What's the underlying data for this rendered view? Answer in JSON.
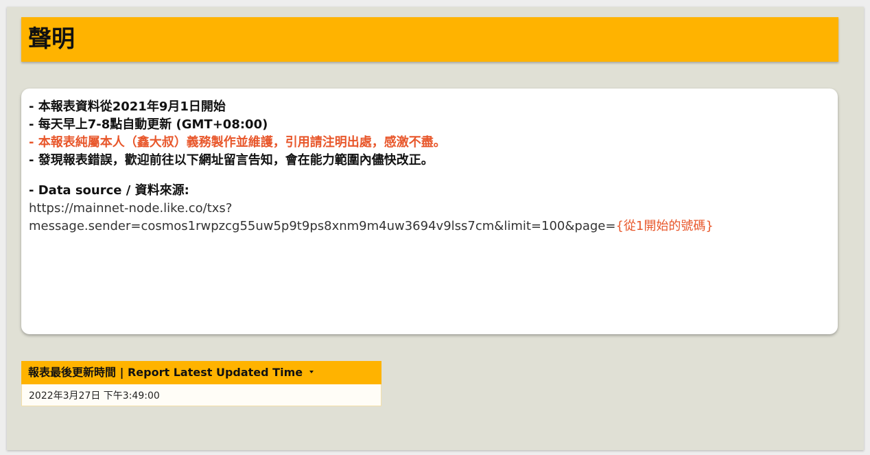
{
  "title": "聲明",
  "notice": {
    "lines": [
      "- 本報表資料從2021年9月1日開始",
      "- 每天早上7-8點自動更新 (GMT+08:00)",
      "- 本報表純屬本人（鑫大叔）義務製作並維護，引用請注明出處，感激不盡。",
      "- 發現報表錯誤，歡迎前往以下網址留言告知，會在能力範圍內儘快改正。"
    ],
    "source_label": "- Data source / 資料來源:",
    "source_url_line1": "https://mainnet-node.like.co/txs?",
    "source_url_line2": "message.sender=cosmos1rwpzcg55uw5p9t9ps8xnm9m4uw3694v9lss7cm&limit=100&page=",
    "source_url_placeholder": "{從1開始的號碼}"
  },
  "report": {
    "header_label": "報表最後更新時間 | Report Latest Updated Time",
    "value": "2022年3月27日 下午3:49:00"
  },
  "colors": {
    "accent": "#ffb300",
    "highlight": "#e8572b",
    "background": "#e0e0d5"
  }
}
